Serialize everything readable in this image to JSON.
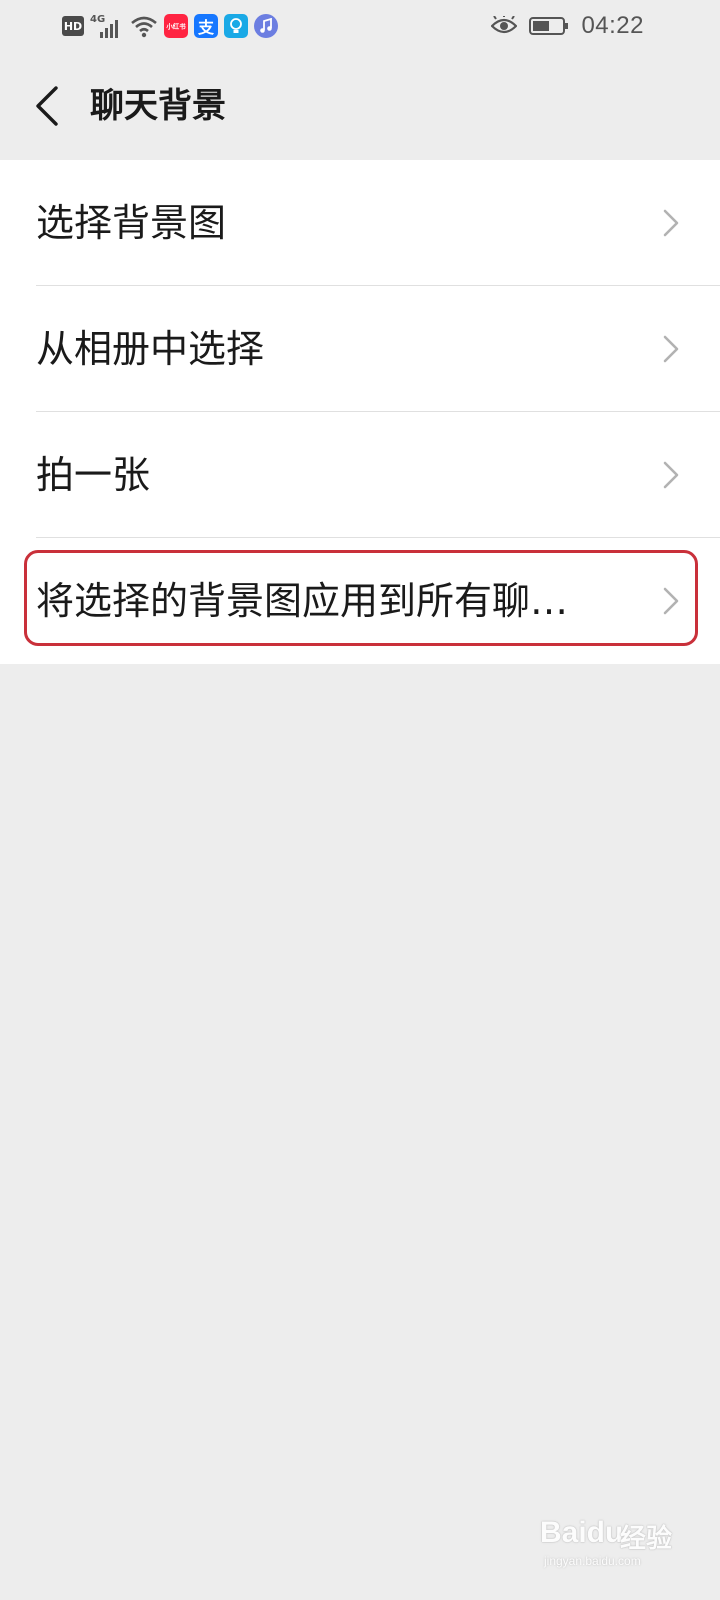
{
  "status_bar": {
    "hd": "HD",
    "network": "4G",
    "apps": [
      {
        "icon": "xiaohongshu-icon",
        "label": "小红书",
        "color": "#ff2442"
      },
      {
        "icon": "alipay-icon",
        "label": "支",
        "color": "#1677ff"
      },
      {
        "icon": "lightbulb-app-icon",
        "label": "",
        "color": "#1aa9e6"
      },
      {
        "icon": "music-app-icon",
        "label": "",
        "color": "#6c7ee1"
      }
    ],
    "eye_icon": "eye-icon",
    "battery_icon": "battery-icon",
    "time": "04:22"
  },
  "header": {
    "title": "聊天背景",
    "back_icon": "chevron-left-icon"
  },
  "menu": {
    "items": [
      {
        "label": "选择背景图"
      },
      {
        "label": "从相册中选择"
      },
      {
        "label": "拍一张"
      },
      {
        "label": "将选择的背景图应用到所有聊…"
      }
    ]
  },
  "annotation": {
    "highlight_color": "#c9303a",
    "highlighted_item_index": 3
  },
  "colors": {
    "background": "#ededed",
    "list_background": "#ffffff",
    "text": "#1a1a1a",
    "chevron": "#b2b2b2"
  },
  "watermark": {
    "brand": "Baidu",
    "cn": "经验",
    "url": "jingyan.baidu.com"
  }
}
